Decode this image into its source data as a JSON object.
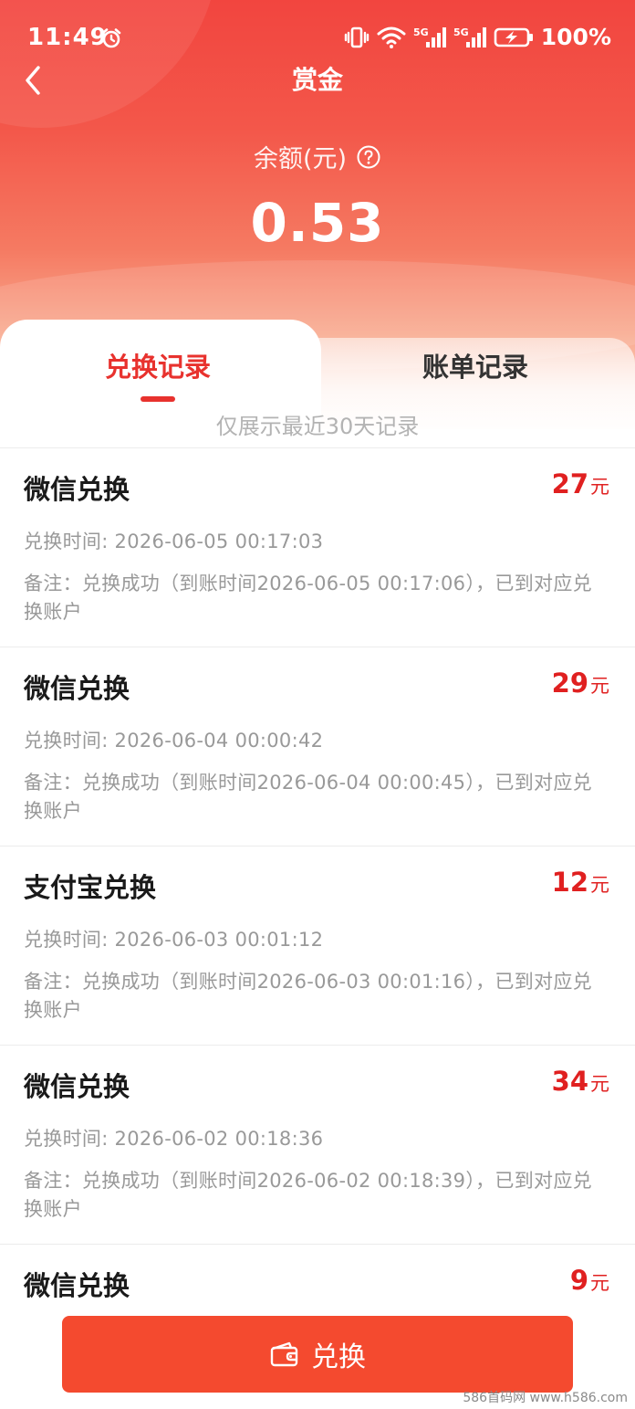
{
  "status_bar": {
    "time": "11:49",
    "battery": "100%",
    "network_1": "5G",
    "network_2": "5G",
    "icons": [
      "alarm-icon",
      "vibrate-icon",
      "wifi-icon",
      "signal-icon",
      "battery-charging-icon"
    ]
  },
  "nav": {
    "title": "赏金"
  },
  "balance": {
    "label": "余额(元)",
    "value": "0.53"
  },
  "tabs": [
    {
      "label": "兑换记录",
      "active": true
    },
    {
      "label": "账单记录",
      "active": false
    }
  ],
  "notice": "仅展示最近30天记录",
  "records": [
    {
      "title": "微信兑换",
      "amount": "27",
      "unit": "元",
      "time": "兑换时间: 2026-06-05 00:17:03",
      "note": "备注：兑换成功（到账时间2026-06-05 00:17:06），已到对应兑换账户"
    },
    {
      "title": "微信兑换",
      "amount": "29",
      "unit": "元",
      "time": "兑换时间: 2026-06-04 00:00:42",
      "note": "备注：兑换成功（到账时间2026-06-04 00:00:45），已到对应兑换账户"
    },
    {
      "title": "支付宝兑换",
      "amount": "12",
      "unit": "元",
      "time": "兑换时间: 2026-06-03 00:01:12",
      "note": "备注：兑换成功（到账时间2026-06-03 00:01:16），已到对应兑换账户"
    },
    {
      "title": "微信兑换",
      "amount": "34",
      "unit": "元",
      "time": "兑换时间: 2026-06-02 00:18:36",
      "note": "备注：兑换成功（到账时间2026-06-02 00:18:39），已到对应兑换账户"
    },
    {
      "title": "微信兑换",
      "amount": "9",
      "unit": "元",
      "time": "",
      "note": ""
    }
  ],
  "action": {
    "label": "兑换"
  },
  "watermark": "586首码网 www.h586.com",
  "colors": {
    "accent": "#e8322e",
    "button": "#f44a2f",
    "amount": "#e02020"
  }
}
